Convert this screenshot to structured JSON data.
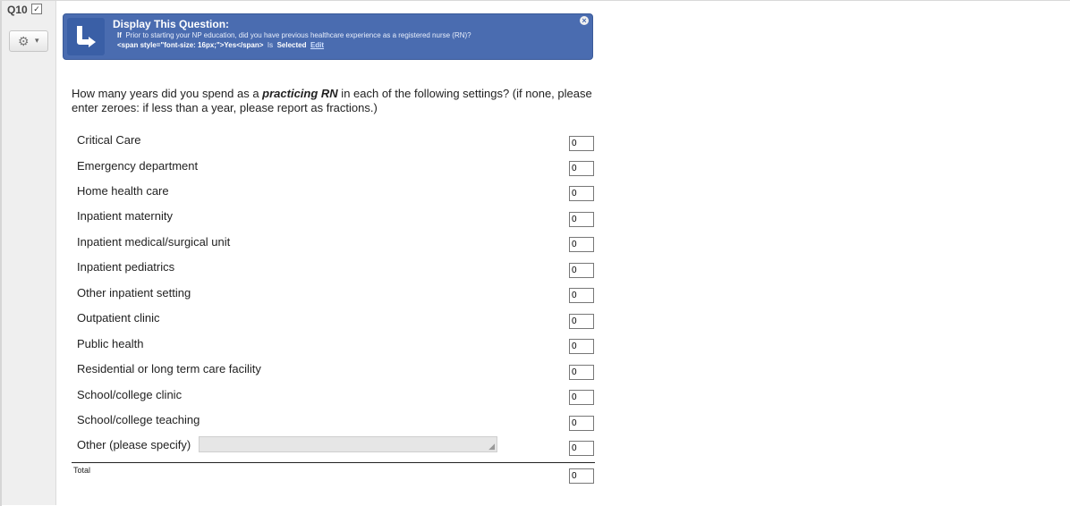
{
  "question": {
    "id": "Q10",
    "checkbox_mark": "✓",
    "text_before": "How many years did you spend as a ",
    "text_emphasis": "practicing RN",
    "text_after": " in each of the following settings? (if none, please enter zeroes: if less than a year, please report as fractions.)"
  },
  "toolbar": {
    "gear_icon": "⚙",
    "chevron_icon": "▾"
  },
  "display_logic": {
    "title": "Display This Question:",
    "if_label": "If",
    "condition": "Prior to starting your NP education, did you have previous healthcare experience as a registered nurse (RN)?",
    "answer": "<span style=\"font-size: 16px;\">Yes</span>",
    "is_label": "Is",
    "state": "Selected",
    "edit_label": "Edit",
    "close_icon": "×",
    "accent_color": "#4a6cb0"
  },
  "rows": [
    {
      "label": "Critical Care",
      "value": "0"
    },
    {
      "label": "Emergency department",
      "value": "0"
    },
    {
      "label": "Home health care",
      "value": "0"
    },
    {
      "label": "Inpatient maternity",
      "value": "0"
    },
    {
      "label": "Inpatient medical/surgical unit",
      "value": "0"
    },
    {
      "label": "Inpatient pediatrics",
      "value": "0"
    },
    {
      "label": "Other inpatient setting",
      "value": "0"
    },
    {
      "label": "Outpatient clinic",
      "value": "0"
    },
    {
      "label": "Public health",
      "value": "0"
    },
    {
      "label": "Residential or long term care facility",
      "value": "0"
    },
    {
      "label": "School/college clinic",
      "value": "0"
    },
    {
      "label": "School/college teaching",
      "value": "0"
    },
    {
      "label": "Other (please specify)",
      "value": "0"
    }
  ],
  "total": {
    "label": "Total",
    "value": "0"
  }
}
